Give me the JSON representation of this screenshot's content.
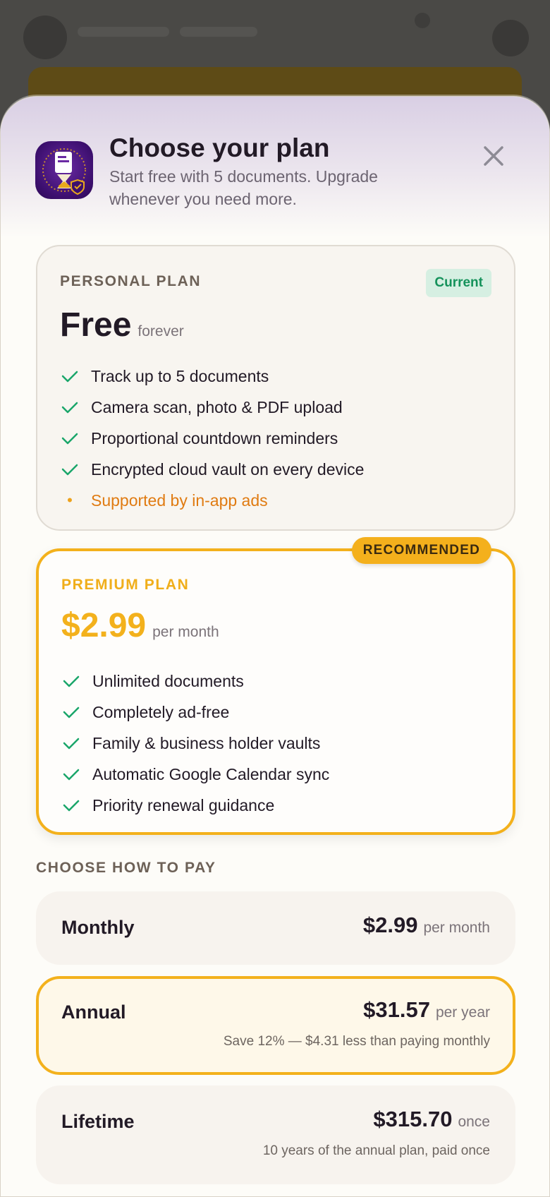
{
  "header": {
    "title": "Choose your plan",
    "subtitle": "Start free with 5 documents. Upgrade whenever you need more."
  },
  "icons": {
    "app": "app-logo-icon",
    "close": "close-icon",
    "check": "check-icon",
    "bullet": "bullet-icon"
  },
  "colors": {
    "accent": "#f3b11c",
    "success": "#15925b",
    "ad_warning": "#e07b12",
    "app_icon": "#3c0f6e"
  },
  "free_plan": {
    "label": "PERSONAL PLAN",
    "badge": "Current",
    "price": "Free",
    "price_unit": "forever",
    "features": [
      "Track up to 5 documents",
      "Camera scan, photo & PDF upload",
      "Proportional countdown reminders",
      "Encrypted cloud vault on every device"
    ],
    "ad_note": "Supported by in-app ads"
  },
  "premium_plan": {
    "badge": "RECOMMENDED",
    "label": "PREMIUM PLAN",
    "price": "$2.99",
    "price_unit": "per month",
    "features": [
      "Unlimited documents",
      "Completely ad-free",
      "Family & business holder vaults",
      "Automatic Google Calendar sync",
      "Priority renewal guidance"
    ]
  },
  "payment": {
    "heading": "CHOOSE HOW TO PAY",
    "options": [
      {
        "name": "Monthly",
        "price": "$2.99",
        "unit": "per month",
        "note": ""
      },
      {
        "name": "Annual",
        "price": "$31.57",
        "unit": "per year",
        "note": "Save 12% — $4.31 less than paying monthly"
      },
      {
        "name": "Lifetime",
        "price": "$315.70",
        "unit": "once",
        "note": "10 years of the annual plan, paid once"
      }
    ],
    "selected": "Annual"
  }
}
